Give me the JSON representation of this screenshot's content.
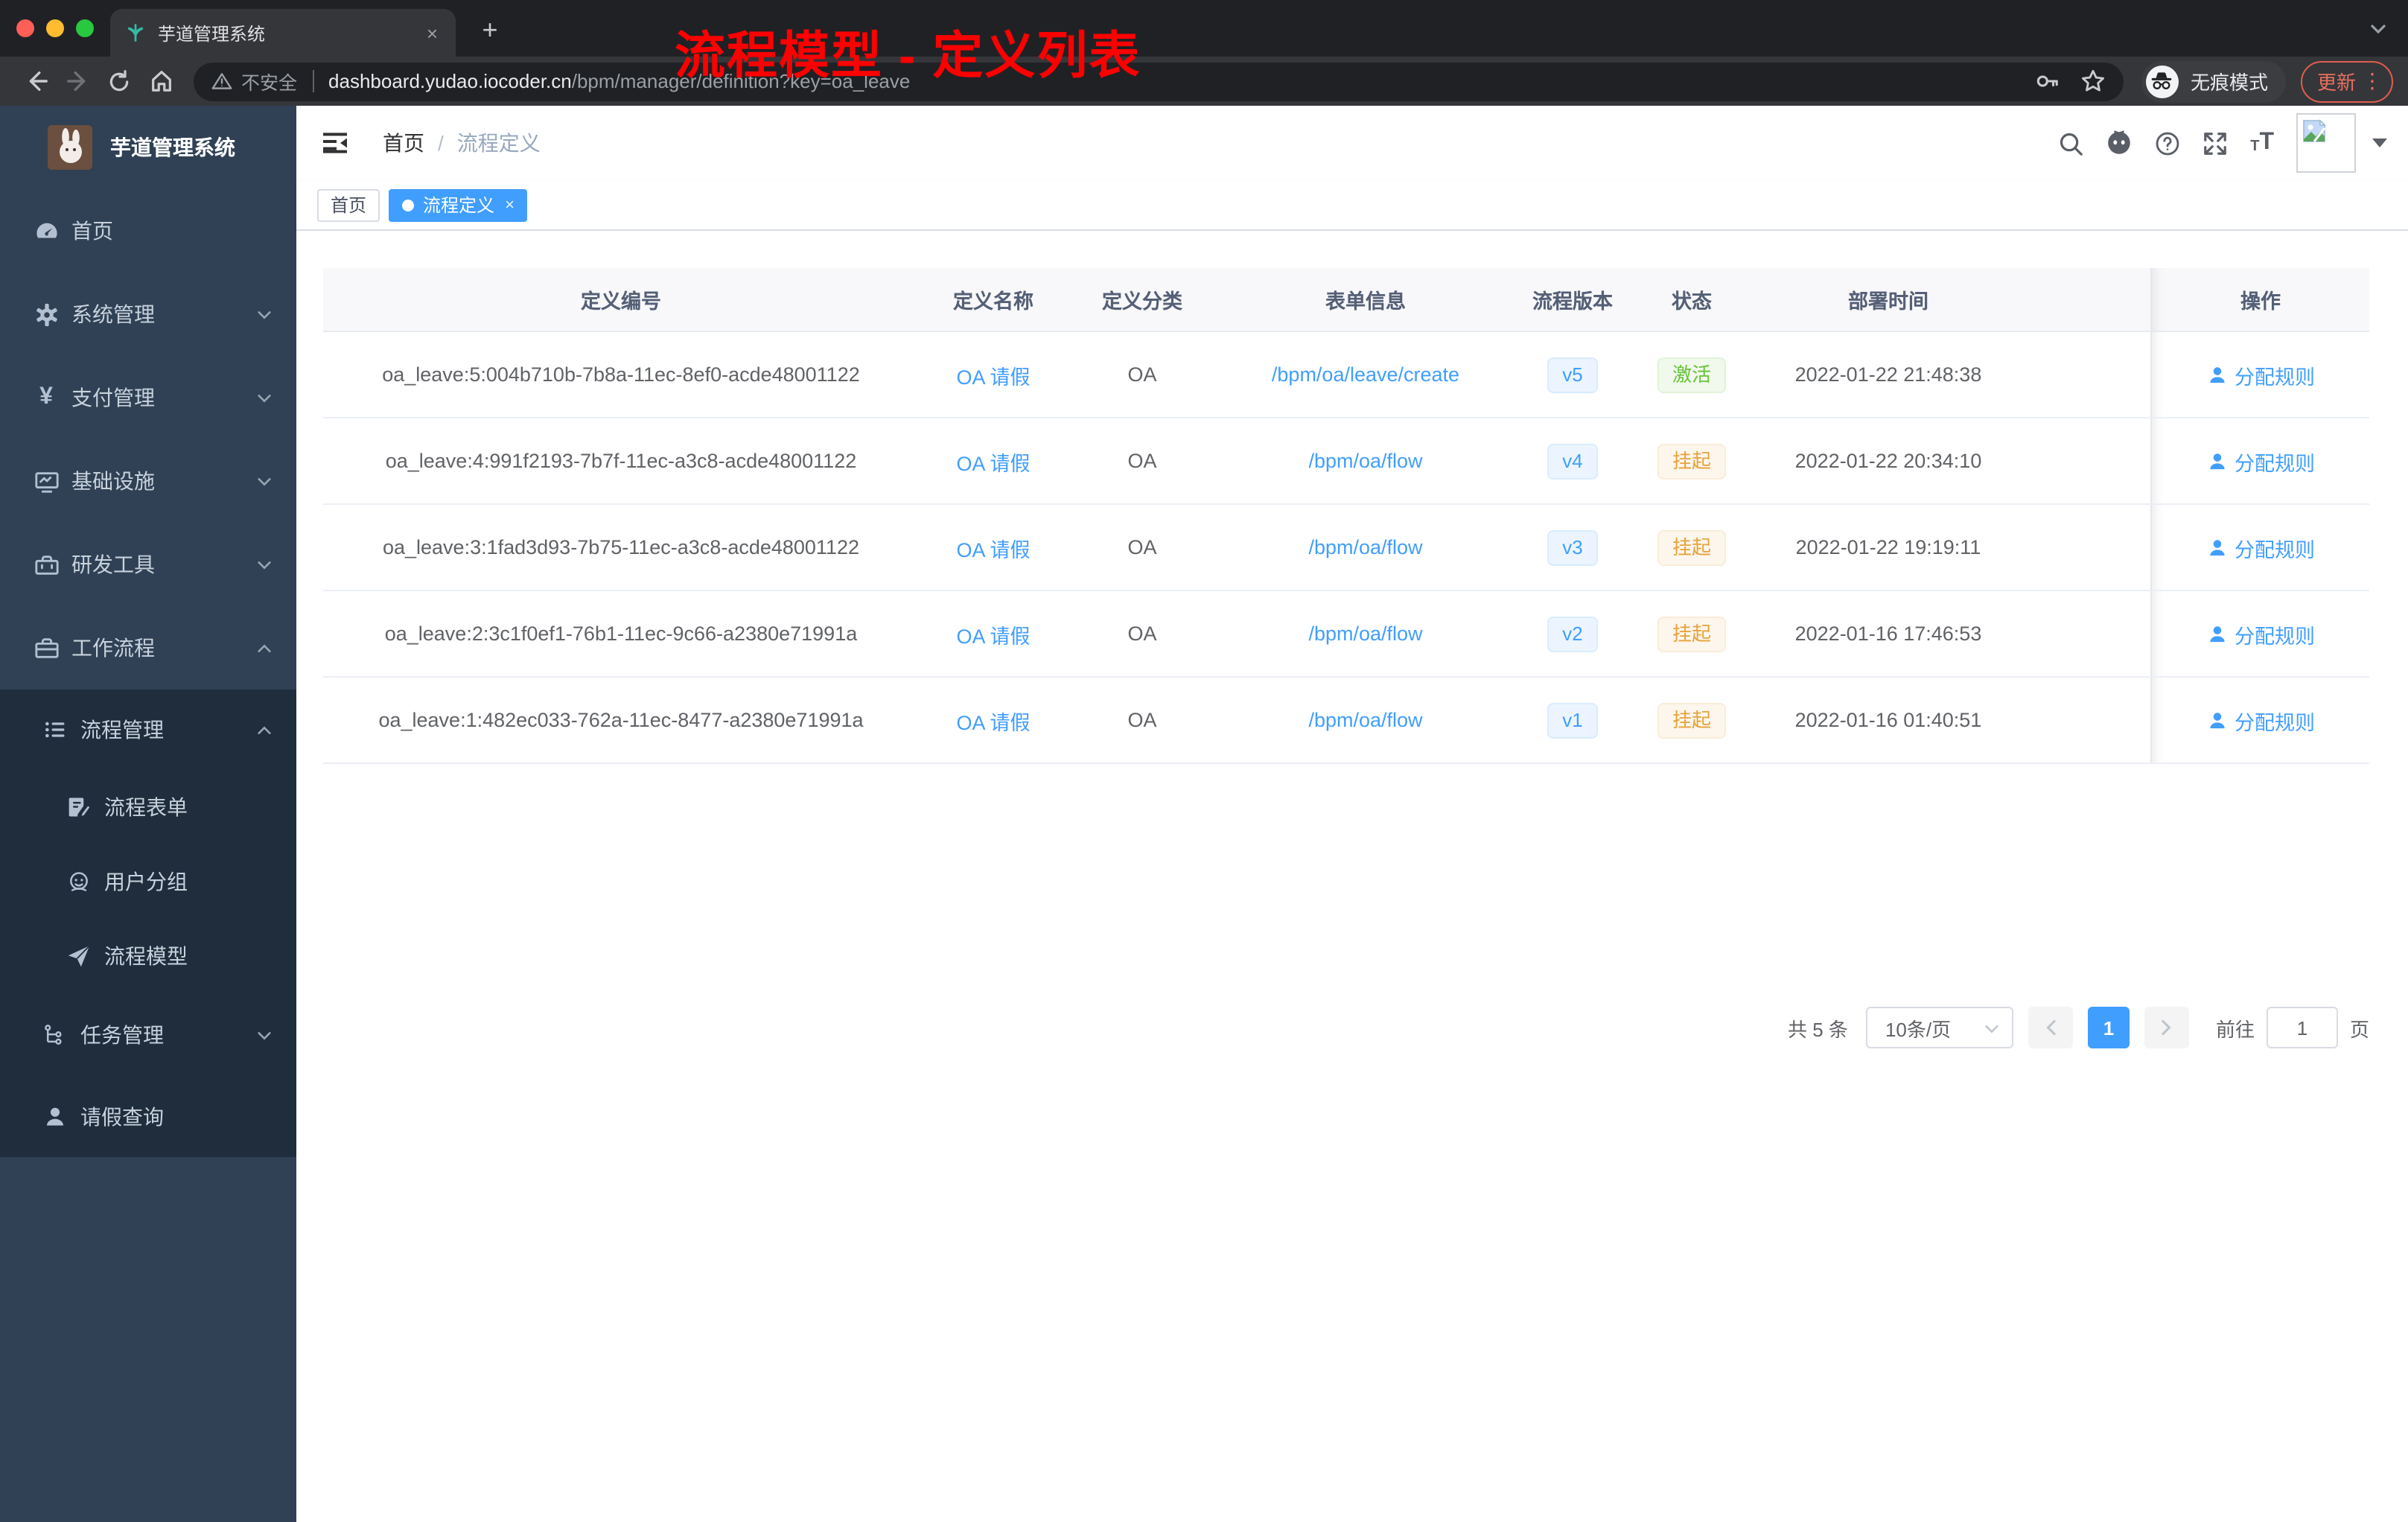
{
  "colors": {
    "accent": "#409eff",
    "success": "#67c23a",
    "warning": "#e6a23c",
    "annotation_red": "#ff0000",
    "sidebar_bg": "#304156",
    "submenu_bg": "#1f2d3d",
    "tag_active_bg": "#409eff"
  },
  "browser": {
    "tab_title": "芋道管理系统",
    "tab_close": "×",
    "new_tab": "+",
    "security_label": "不安全",
    "url_host": "dashboard.yudao.iocoder.cn",
    "url_path": "/bpm/manager/definition?key=oa_leave",
    "incognito_label": "无痕模式",
    "update_label": "更新",
    "menu_dots": "⋮"
  },
  "icons": {
    "favicon": "teal sprout leaf",
    "traffic_lights": [
      "#ff5f57",
      "#febc2e",
      "#28c840"
    ],
    "address_left": [
      "back-arrow",
      "forward-arrow",
      "reload",
      "home"
    ],
    "address_right": [
      "key",
      "star"
    ],
    "navbar_right": [
      "search",
      "github",
      "help-circle",
      "fullscreen",
      "font-size",
      "broken-avatar",
      "caret-down"
    ]
  },
  "sidebar": {
    "logo_title": "芋道管理系统",
    "items": [
      {
        "label": "首页",
        "icon": "dashboard-icon"
      },
      {
        "label": "系统管理",
        "icon": "gear-icon",
        "chevron": "down"
      },
      {
        "label": "支付管理",
        "icon": "yen-icon",
        "chevron": "down"
      },
      {
        "label": "基础设施",
        "icon": "monitor-icon",
        "chevron": "down"
      },
      {
        "label": "研发工具",
        "icon": "toolbox-icon",
        "chevron": "down"
      },
      {
        "label": "工作流程",
        "icon": "briefcase-icon",
        "chevron": "up"
      }
    ],
    "submenu": {
      "group_label": "流程管理",
      "group_chevron": "up",
      "children": [
        {
          "label": "流程表单",
          "icon": "form-icon"
        },
        {
          "label": "用户分组",
          "icon": "user-group-icon"
        },
        {
          "label": "流程模型",
          "icon": "paper-plane-icon"
        }
      ],
      "task_label": "任务管理",
      "task_chevron": "down",
      "leave_label": "请假查询"
    }
  },
  "navbar": {
    "breadcrumb_first": "首页",
    "breadcrumb_sep": "/",
    "breadcrumb_current": "流程定义",
    "annotation": "流程模型 - 定义列表"
  },
  "tags": {
    "home": "首页",
    "active": "流程定义",
    "active_close": "×"
  },
  "table": {
    "columns": [
      "定义编号",
      "定义名称",
      "定义分类",
      "表单信息",
      "流程版本",
      "状态",
      "部署时间",
      "操作"
    ],
    "action_label": "分配规则",
    "rows": [
      {
        "id": "oa_leave:5:004b710b-7b8a-11ec-8ef0-acde48001122",
        "name": "OA 请假",
        "category": "OA",
        "form": "/bpm/oa/leave/create",
        "version": "v5",
        "status": "激活",
        "time": "2022-01-22 21:48:38"
      },
      {
        "id": "oa_leave:4:991f2193-7b7f-11ec-a3c8-acde48001122",
        "name": "OA 请假",
        "category": "OA",
        "form": "/bpm/oa/flow",
        "version": "v4",
        "status": "挂起",
        "time": "2022-01-22 20:34:10"
      },
      {
        "id": "oa_leave:3:1fad3d93-7b75-11ec-a3c8-acde48001122",
        "name": "OA 请假",
        "category": "OA",
        "form": "/bpm/oa/flow",
        "version": "v3",
        "status": "挂起",
        "time": "2022-01-22 19:19:11"
      },
      {
        "id": "oa_leave:2:3c1f0ef1-76b1-11ec-9c66-a2380e71991a",
        "name": "OA 请假",
        "category": "OA",
        "form": "/bpm/oa/flow",
        "version": "v2",
        "status": "挂起",
        "time": "2022-01-16 17:46:53"
      },
      {
        "id": "oa_leave:1:482ec033-762a-11ec-8477-a2380e71991a",
        "name": "OA 请假",
        "category": "OA",
        "form": "/bpm/oa/flow",
        "version": "v1",
        "status": "挂起",
        "time": "2022-01-16 01:40:51"
      }
    ]
  },
  "pagination": {
    "total_label": "共 5 条",
    "page_size_label": "10条/页",
    "current_page": "1",
    "goto_label": "前往",
    "goto_value": "1",
    "page_unit": "页"
  }
}
